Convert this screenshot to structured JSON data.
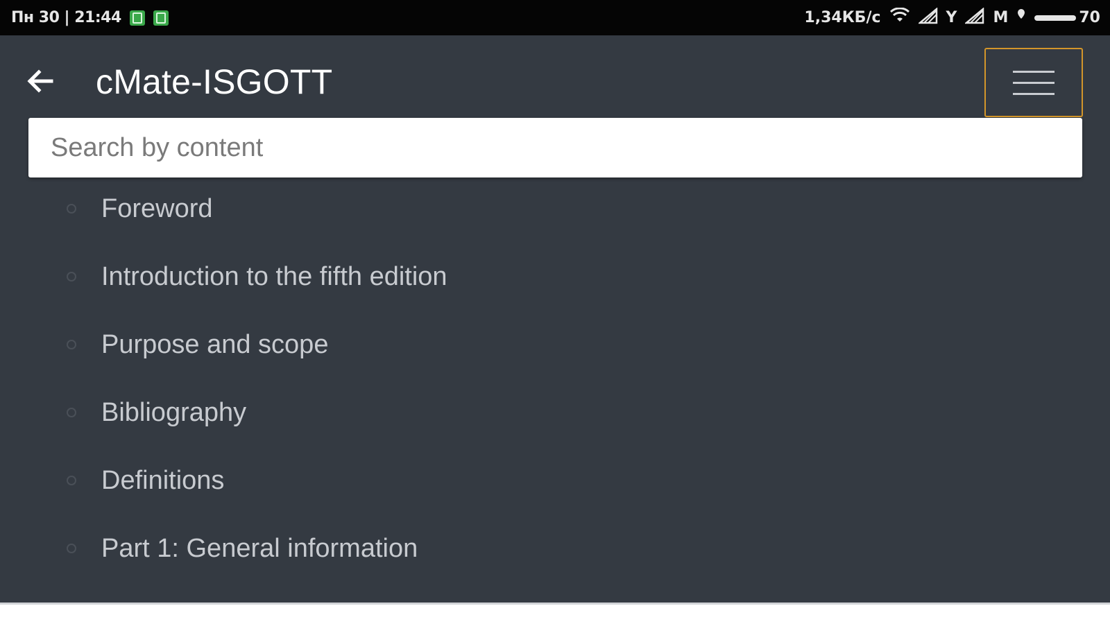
{
  "status_bar": {
    "datetime": "Пн 30 | 21:44",
    "speed": "1,34КБ/с",
    "sim1_label": "Y",
    "sim2_label": "M",
    "battery": "70"
  },
  "toolbar": {
    "title": "cMate-ISGOTT"
  },
  "search": {
    "placeholder": "Search by content",
    "value": ""
  },
  "toc": {
    "items": [
      {
        "label": "Foreword"
      },
      {
        "label": "Introduction to the fifth edition"
      },
      {
        "label": "Purpose and scope"
      },
      {
        "label": "Bibliography"
      },
      {
        "label": "Definitions"
      },
      {
        "label": "Part 1: General information"
      }
    ]
  },
  "colors": {
    "background": "#343a42",
    "menu_highlight": "#d4962a",
    "text": "#c8cbd0"
  }
}
